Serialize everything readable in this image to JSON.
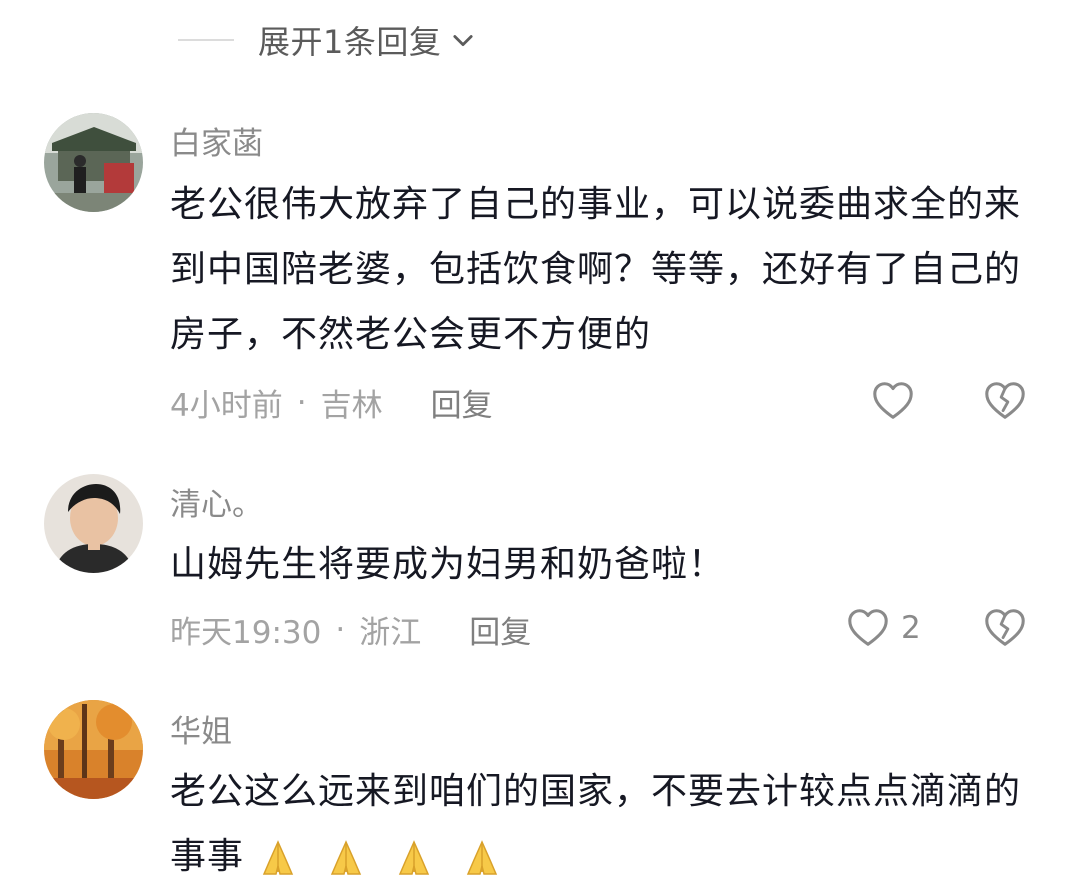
{
  "expand_replies": {
    "label": "展开1条回复"
  },
  "comments": [
    {
      "author": "白家菡",
      "text": "老公很伟大放弃了自己的事业，可以说委曲求全的来到中国陪老婆，包括饮食啊？等等，还好有了自己的房子，不然老公会更不方便的",
      "time": "4小时前",
      "location": "吉林",
      "reply_label": "回复",
      "likes": ""
    },
    {
      "author": "清心。",
      "text": "山姆先生将要成为妇男和奶爸啦！",
      "time": "昨天19:30",
      "location": "浙江",
      "reply_label": "回复",
      "likes": "2"
    },
    {
      "author": "华姐",
      "text": "老公这么远来到咱们的国家，不要去计较点点滴滴的事事",
      "emoji_count": 4,
      "emoji_name": "praying-hands-icon"
    }
  ],
  "separator": "·",
  "colors": {
    "text": "#161823",
    "meta": "#a3a3a3",
    "author": "#8a8a8a",
    "icon": "#8a8a8a"
  }
}
